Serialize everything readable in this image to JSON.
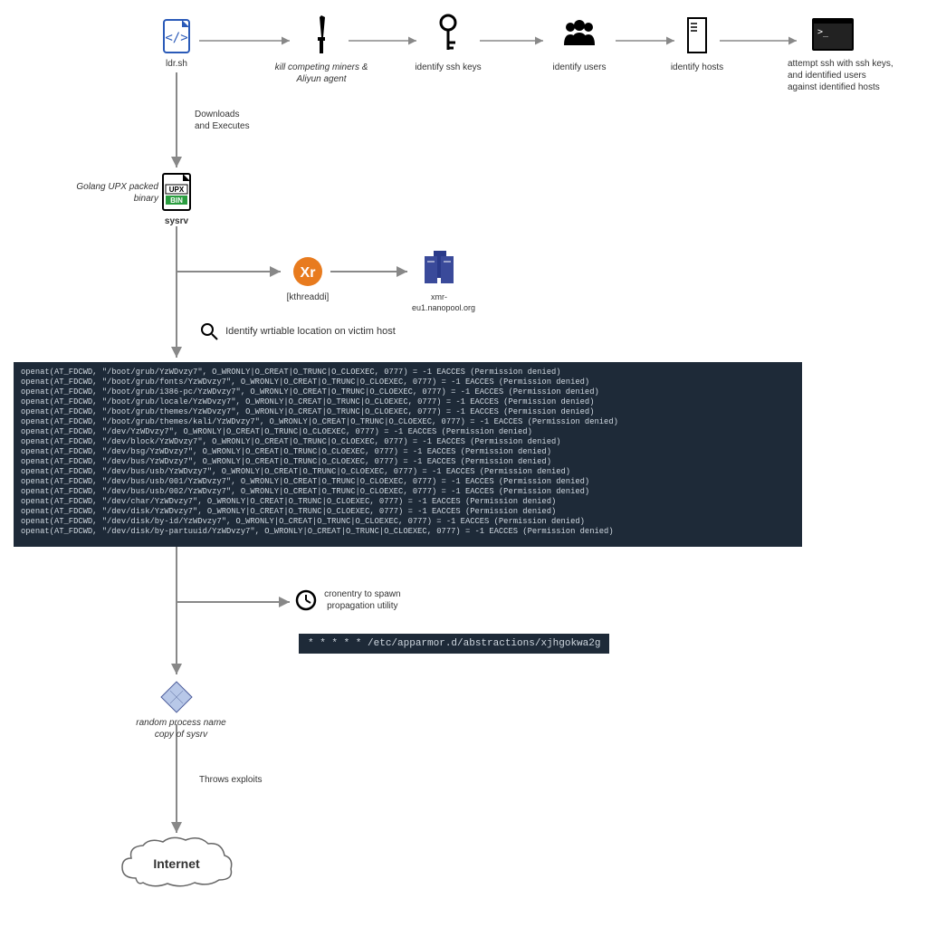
{
  "topRow": {
    "ldr": "ldr.sh",
    "kill": "kill competing miners &\nAliyun agent",
    "sshkeys": "identify ssh keys",
    "users": "identify users",
    "hosts": "identify hosts",
    "attempt": "attempt ssh with ssh keys,\nand identified users\nagainst identified hosts"
  },
  "downloads": "Downloads\nand Executes",
  "golang": "Golang UPX packed\nbinary",
  "sysrv": "sysrv",
  "kthreaddi": "[kthreaddi]",
  "nanopool": "xmr-eu1.nanopool.org",
  "identifyWritable": "Identify wrtiable location on victim host",
  "terminalLines": [
    "openat(AT_FDCWD, \"/boot/grub/YzWDvzy7\", O_WRONLY|O_CREAT|O_TRUNC|O_CLOEXEC, 0777) = -1 EACCES (Permission denied)",
    "openat(AT_FDCWD, \"/boot/grub/fonts/YzWDvzy7\", O_WRONLY|O_CREAT|O_TRUNC|O_CLOEXEC, 0777) = -1 EACCES (Permission denied)",
    "openat(AT_FDCWD, \"/boot/grub/i386-pc/YzWDvzy7\", O_WRONLY|O_CREAT|O_TRUNC|O_CLOEXEC, 0777) = -1 EACCES (Permission denied)",
    "openat(AT_FDCWD, \"/boot/grub/locale/YzWDvzy7\", O_WRONLY|O_CREAT|O_TRUNC|O_CLOEXEC, 0777) = -1 EACCES (Permission denied)",
    "openat(AT_FDCWD, \"/boot/grub/themes/YzWDvzy7\", O_WRONLY|O_CREAT|O_TRUNC|O_CLOEXEC, 0777) = -1 EACCES (Permission denied)",
    "openat(AT_FDCWD, \"/boot/grub/themes/kali/YzWDvzy7\", O_WRONLY|O_CREAT|O_TRUNC|O_CLOEXEC, 0777) = -1 EACCES (Permission denied)",
    "openat(AT_FDCWD, \"/dev/YzWDvzy7\", O_WRONLY|O_CREAT|O_TRUNC|O_CLOEXEC, 0777) = -1 EACCES (Permission denied)",
    "openat(AT_FDCWD, \"/dev/block/YzWDvzy7\", O_WRONLY|O_CREAT|O_TRUNC|O_CLOEXEC, 0777) = -1 EACCES (Permission denied)",
    "openat(AT_FDCWD, \"/dev/bsg/YzWDvzy7\", O_WRONLY|O_CREAT|O_TRUNC|O_CLOEXEC, 0777) = -1 EACCES (Permission denied)",
    "openat(AT_FDCWD, \"/dev/bus/YzWDvzy7\", O_WRONLY|O_CREAT|O_TRUNC|O_CLOEXEC, 0777) = -1 EACCES (Permission denied)",
    "openat(AT_FDCWD, \"/dev/bus/usb/YzWDvzy7\", O_WRONLY|O_CREAT|O_TRUNC|O_CLOEXEC, 0777) = -1 EACCES (Permission denied)",
    "openat(AT_FDCWD, \"/dev/bus/usb/001/YzWDvzy7\", O_WRONLY|O_CREAT|O_TRUNC|O_CLOEXEC, 0777) = -1 EACCES (Permission denied)",
    "openat(AT_FDCWD, \"/dev/bus/usb/002/YzWDvzy7\", O_WRONLY|O_CREAT|O_TRUNC|O_CLOEXEC, 0777) = -1 EACCES (Permission denied)",
    "openat(AT_FDCWD, \"/dev/char/YzWDvzy7\", O_WRONLY|O_CREAT|O_TRUNC|O_CLOEXEC, 0777) = -1 EACCES (Permission denied)",
    "openat(AT_FDCWD, \"/dev/disk/YzWDvzy7\", O_WRONLY|O_CREAT|O_TRUNC|O_CLOEXEC, 0777) = -1 EACCES (Permission denied)",
    "openat(AT_FDCWD, \"/dev/disk/by-id/YzWDvzy7\", O_WRONLY|O_CREAT|O_TRUNC|O_CLOEXEC, 0777) = -1 EACCES (Permission denied)",
    "openat(AT_FDCWD, \"/dev/disk/by-partuuid/YzWDvzy7\", O_WRONLY|O_CREAT|O_TRUNC|O_CLOEXEC, 0777) = -1 EACCES (Permission denied)"
  ],
  "cronLabel": "cronentry to spawn\npropagation utility",
  "cronLine": "* * * * * /etc/apparmor.d/abstractions/xjhgokwa2g",
  "randomProcess": "random process name\ncopy of sysrv",
  "throws": "Throws exploits",
  "internet": "Internet",
  "upxBadge": "UPX",
  "binBadge": "BIN"
}
